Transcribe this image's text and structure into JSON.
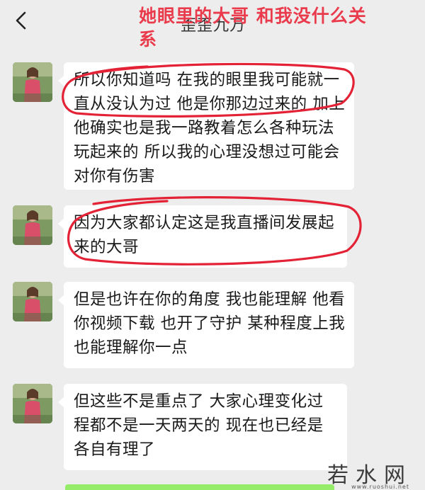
{
  "header": {
    "back_icon": "chevron-left-icon",
    "title": "歪歪九万",
    "annotation": "她眼里的大哥 和我没什么关系"
  },
  "messages": [
    {
      "avatar_icon": "avatar-photo",
      "text": "所以你知道吗 在我的眼里我可能就一直从没认为过 他是你那边过来的  加上他确实也是我一路教着怎么各种玩法玩起来的 所以我的心理没想过可能会对你有伤害"
    },
    {
      "avatar_icon": "avatar-photo",
      "text": "因为大家都认定这是我直播间发展起来的大哥"
    },
    {
      "avatar_icon": "avatar-photo",
      "text": "但是也许在你的角度 我也能理解 他看你视频下载 也开了守护 某种程度上我也能理解你一点"
    },
    {
      "avatar_icon": "avatar-photo",
      "text": "但这些不是重点了 大家心理变化过程都不是一天两天的 现在也已经是各自有理了"
    }
  ],
  "watermark": {
    "text": "若水网",
    "sub": "www.ruoshui.net"
  },
  "colors": {
    "background": "#ededed",
    "bubble": "#ffffff",
    "annotation_red": "#ea3b4c",
    "sent_bubble_green": "#95ec69"
  }
}
